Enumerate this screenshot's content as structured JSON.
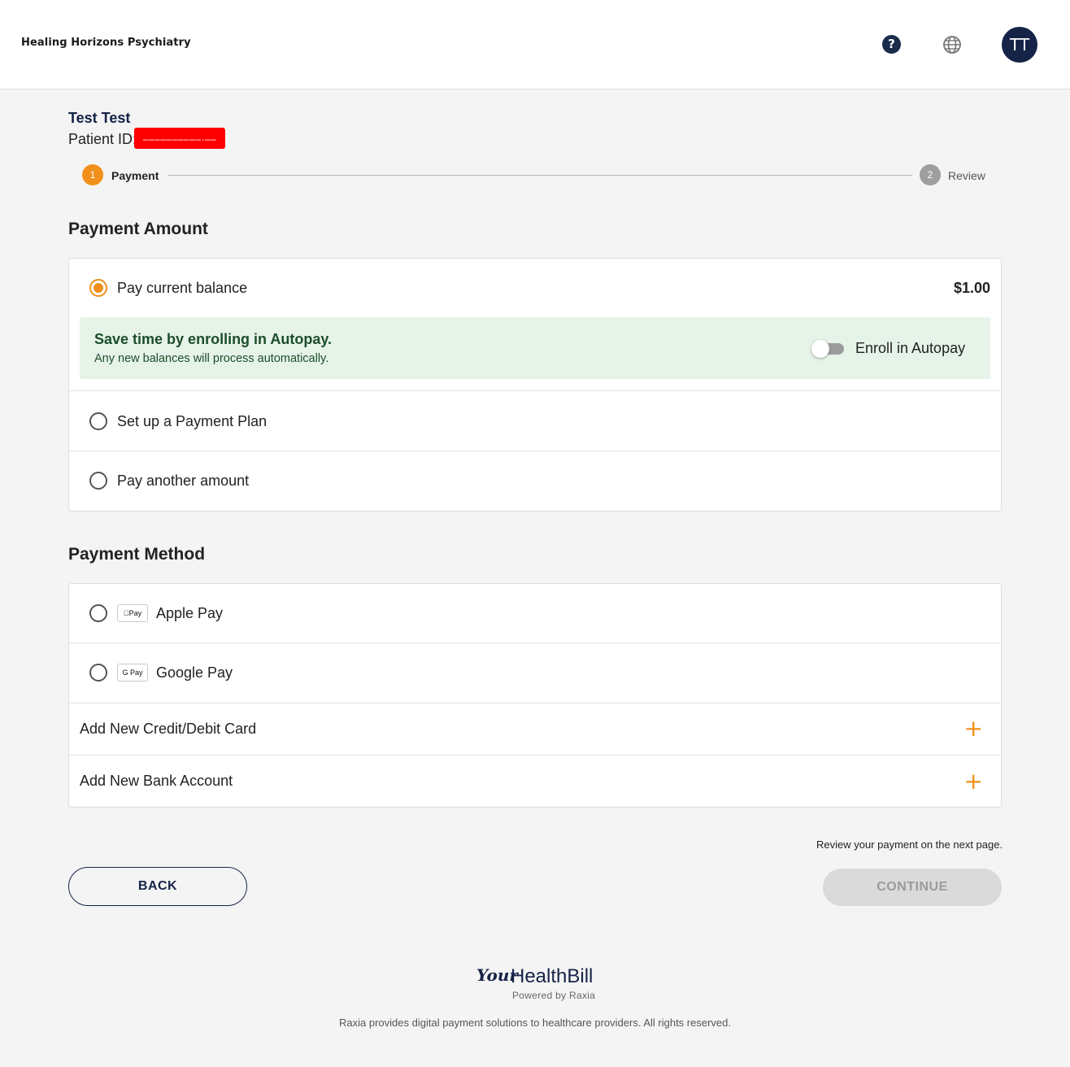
{
  "header": {
    "brand": "Healing Horizons Psychiatry",
    "help_icon": "question-circle-icon",
    "help_glyph": "?",
    "language_icon": "globe-icon",
    "avatar_initials": "TT"
  },
  "patient": {
    "name": "Test Test",
    "id_label": "Patient ID:",
    "id_value": "––––––––––·––"
  },
  "steps": [
    {
      "number": "1",
      "label": "Payment",
      "state": "active",
      "color": "#f0901a"
    },
    {
      "number": "2",
      "label": "Review",
      "state": "inactive",
      "color": "#9e9e9e"
    }
  ],
  "payment_amount": {
    "title": "Payment Amount",
    "options": [
      {
        "label": "Pay current balance",
        "value": "$1.00",
        "selected": true
      },
      {
        "label": "Set up a Payment Plan",
        "selected": false
      },
      {
        "label": "Pay another amount",
        "selected": false
      }
    ],
    "autopay": {
      "title": "Save time by enrolling in Autopay.",
      "subtitle": "Any new balances will process automatically.",
      "toggle_label": "Enroll in Autopay",
      "enabled": false
    }
  },
  "payment_method": {
    "title": "Payment Method",
    "wallets": [
      {
        "label": "Apple Pay",
        "badge": "Pay",
        "icon": "apple-pay-icon",
        "selected": false
      },
      {
        "label": "Google Pay",
        "badge": "G Pay",
        "icon": "google-pay-icon",
        "selected": false
      }
    ],
    "add_options": [
      {
        "label": "Add New Credit/Debit Card",
        "icon": "plus-icon",
        "glyph": "+"
      },
      {
        "label": "Add New Bank Account",
        "icon": "plus-icon",
        "glyph": "+"
      }
    ]
  },
  "actions": {
    "review_note": "Review your payment on the next page.",
    "back_label": "BACK",
    "continue_label": "CONTINUE",
    "continue_enabled": false
  },
  "footer": {
    "logo_your": "Your",
    "logo_healthbill": "HealthBill",
    "powered_by": "Powered by Raxia",
    "copyright": "Raxia provides digital payment solutions to healthcare providers. All rights reserved."
  },
  "colors": {
    "accent": "#f0901a",
    "navy": "#152347",
    "autopay_bg": "#e6f3e8",
    "autopay_text": "#1b4d2a"
  }
}
